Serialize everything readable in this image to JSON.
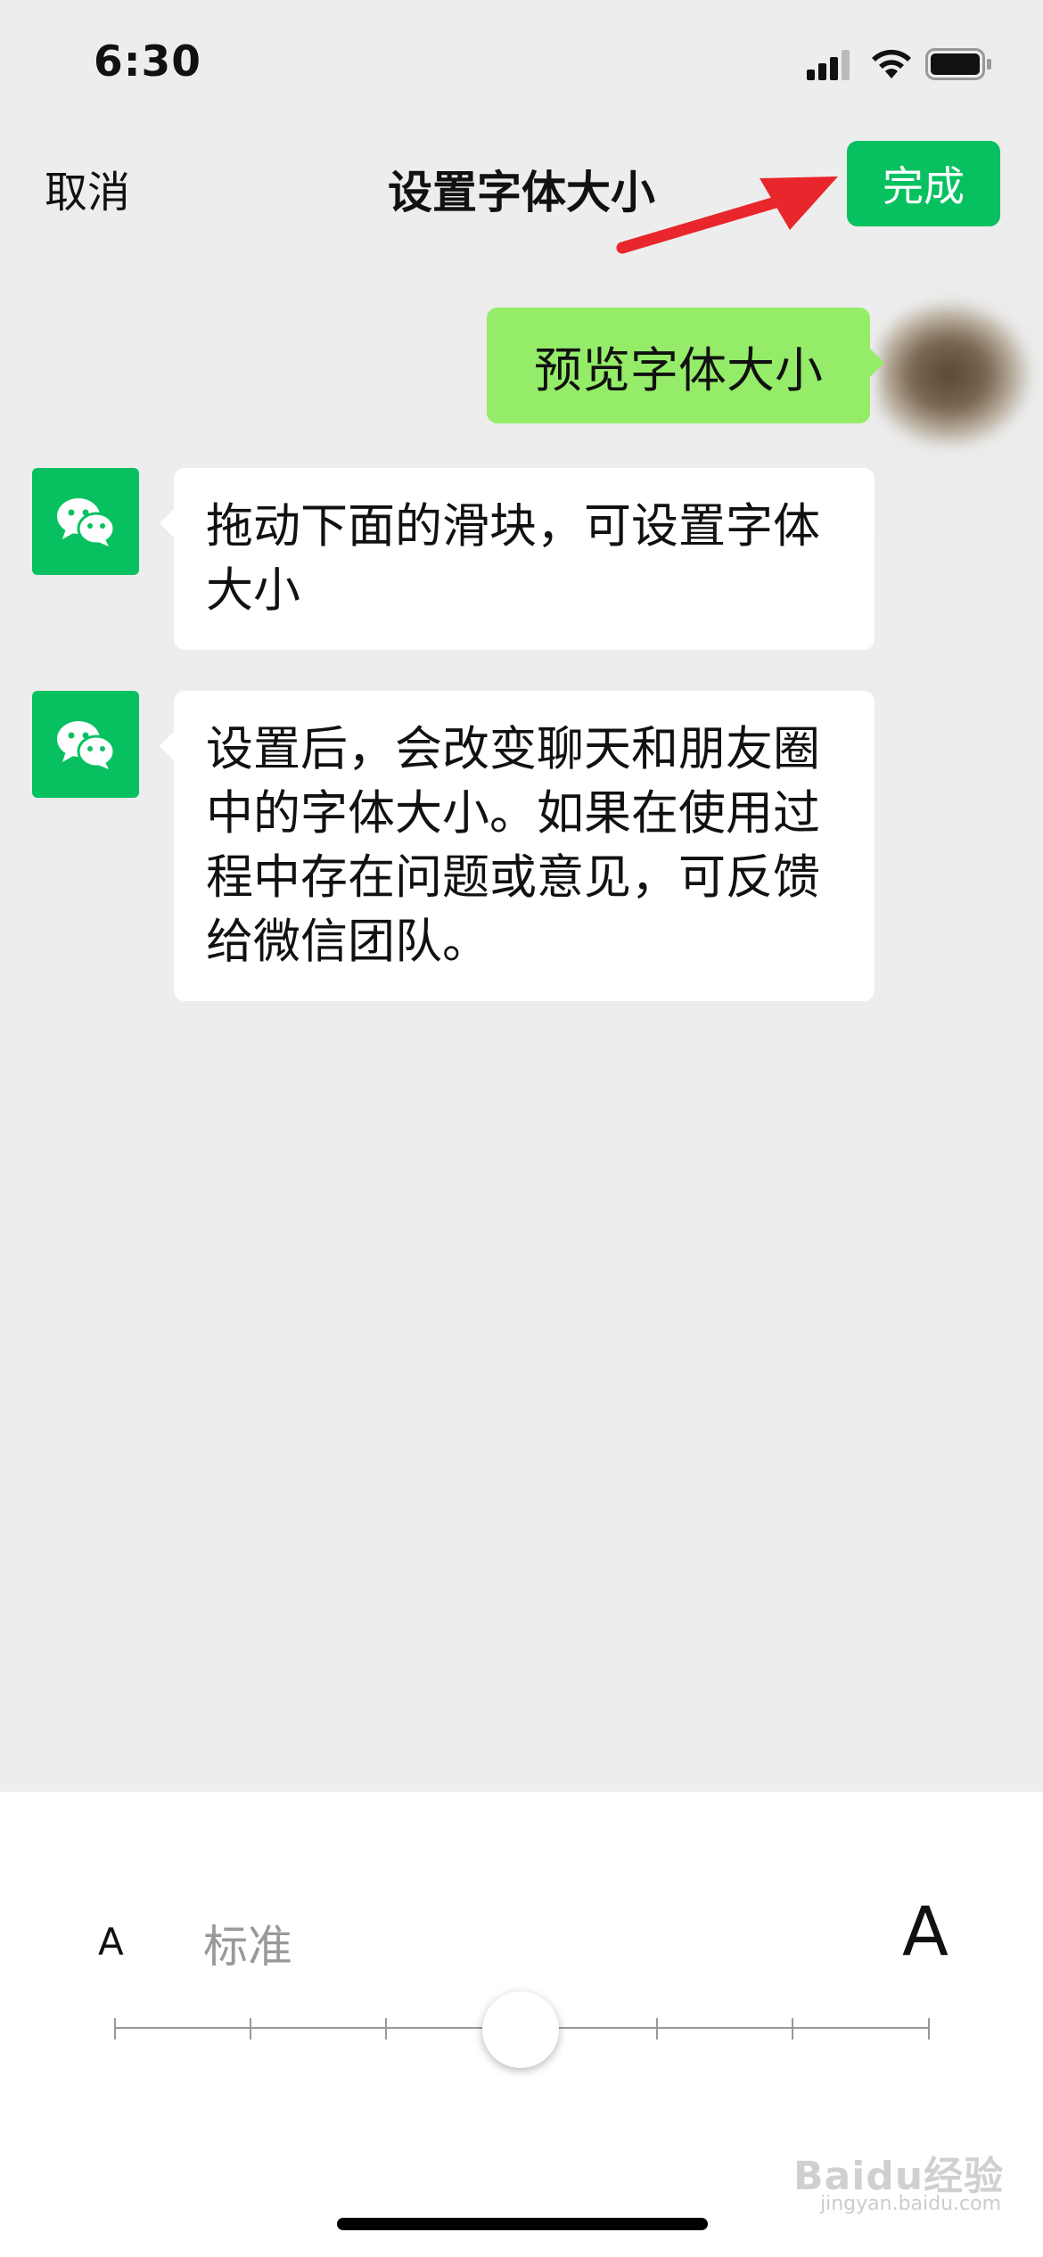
{
  "status_bar": {
    "time": "6:30"
  },
  "nav": {
    "cancel_label": "取消",
    "title": "设置字体大小",
    "done_label": "完成"
  },
  "chat": {
    "self_message": "预览字体大小",
    "messages": [
      "拖动下面的滑块，可设置字体大小",
      "设置后，会改变聊天和朋友圈中的字体大小。如果在使用过程中存在问题或意见，可反馈给微信团队。"
    ]
  },
  "font_panel": {
    "small_label": "A",
    "current_size_label": "标准",
    "large_label": "A",
    "slider": {
      "steps": 7,
      "selected_index": 3
    }
  },
  "watermark": {
    "text": "Baidu经验",
    "sub": "jingyan.baidu.com"
  },
  "colors": {
    "accent": "#07c160",
    "self_bubble": "#95ec69",
    "annotation_arrow": "#e8262b"
  }
}
